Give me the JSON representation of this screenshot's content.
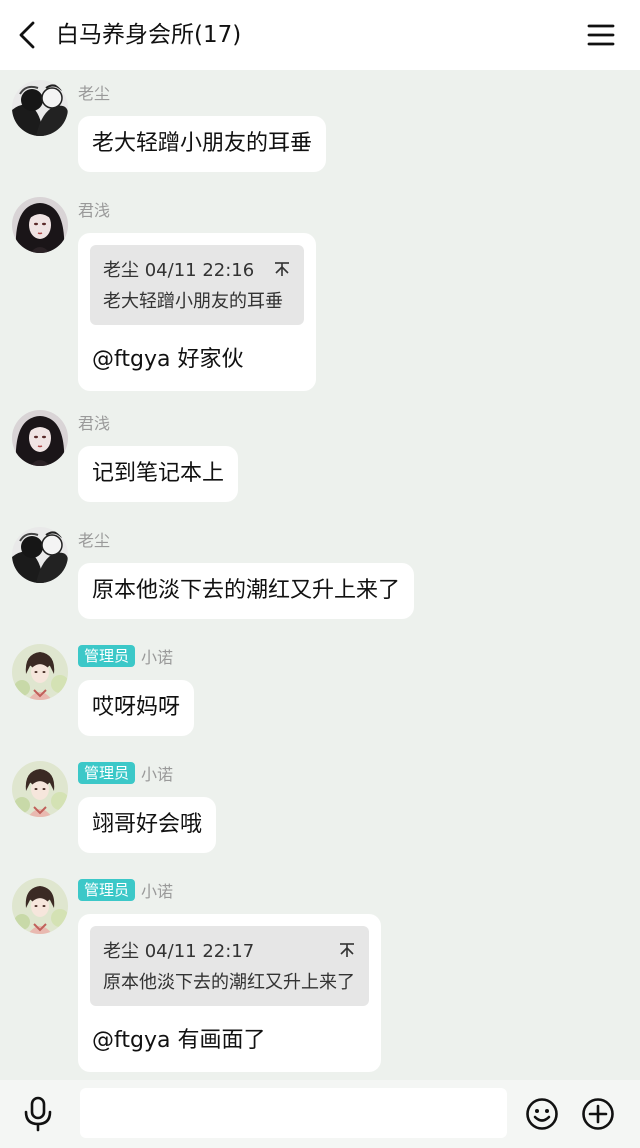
{
  "header": {
    "title": "白马养身会所(17)"
  },
  "messages": [
    {
      "sender": "老尘",
      "text": "老大轻蹭小朋友的耳垂"
    },
    {
      "sender": "君浅",
      "quote_meta": "老尘 04/11 22:16",
      "quote_text": "老大轻蹭小朋友的耳垂",
      "text": "@ftgya 好家伙"
    },
    {
      "sender": "君浅",
      "text": "记到笔记本上"
    },
    {
      "sender": "老尘",
      "text": "原本他淡下去的潮红又升上来了"
    },
    {
      "badge": "管理员",
      "sender": "小诺",
      "text": "哎呀妈呀"
    },
    {
      "badge": "管理员",
      "sender": "小诺",
      "text": "翊哥好会哦"
    },
    {
      "badge": "管理员",
      "sender": "小诺",
      "quote_meta": "老尘 04/11 22:17",
      "quote_text": "原本他淡下去的潮红又升上来了",
      "text": "@ftgya 有画面了"
    }
  ],
  "input": {
    "value": "",
    "placeholder": ""
  },
  "icons": {
    "back": "back-arrow-icon",
    "menu": "menu-icon",
    "mic": "microphone-icon",
    "emoji": "emoji-icon",
    "plus": "plus-icon",
    "pin": "pin-icon"
  }
}
